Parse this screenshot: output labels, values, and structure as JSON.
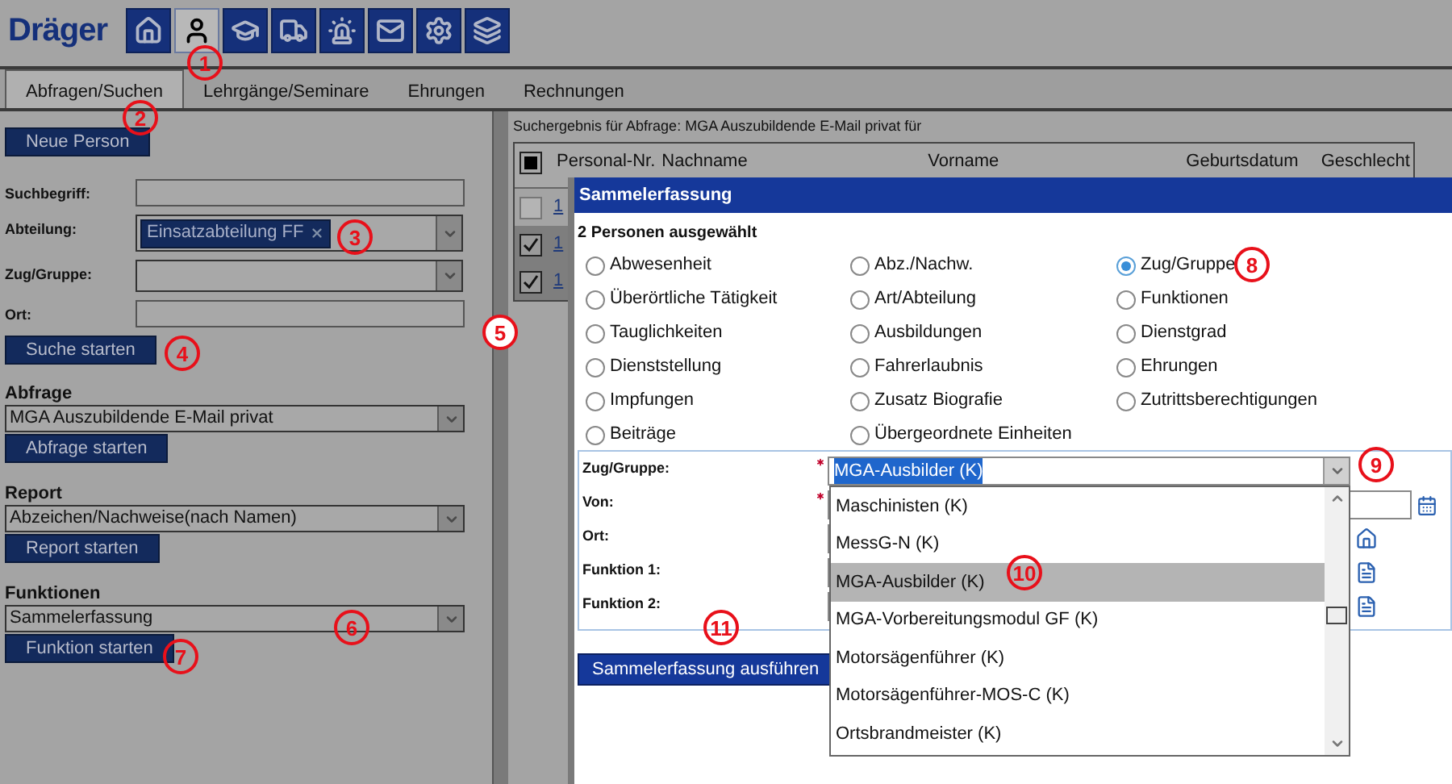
{
  "header": {
    "logo": "Dräger",
    "nav": [
      {
        "kind": "home",
        "selected": false
      },
      {
        "kind": "person",
        "selected": true
      },
      {
        "kind": "training",
        "selected": false
      },
      {
        "kind": "vehicle",
        "selected": false
      },
      {
        "kind": "alarm",
        "selected": false
      },
      {
        "kind": "mail",
        "selected": false
      },
      {
        "kind": "settings",
        "selected": false
      },
      {
        "kind": "layers",
        "selected": false
      }
    ]
  },
  "tabs": [
    {
      "label": "Abfragen/Suchen",
      "selected": true
    },
    {
      "label": "Lehrgänge/Seminare",
      "selected": false
    },
    {
      "label": "Ehrungen",
      "selected": false
    },
    {
      "label": "Rechnungen",
      "selected": false
    }
  ],
  "left_panel": {
    "new_button": "Neue Person",
    "search_fields": [
      {
        "label": "Suchbegriff:",
        "kind": "text"
      },
      {
        "label": "Abteilung:",
        "kind": "select",
        "tags": [
          "Einsatzabteilung FF"
        ]
      },
      {
        "label": "Zug/Gruppe:",
        "kind": "select"
      },
      {
        "label": "Ort:",
        "kind": "text"
      }
    ],
    "search_button": "Suche starten",
    "sections": [
      {
        "title": "Abfrage",
        "value": "MGA Auszubildende E-Mail privat",
        "button": "Abfrage starten"
      },
      {
        "title": "Report",
        "value": "Abzeichen/Nachweise(nach Namen)",
        "button": "Report starten"
      },
      {
        "title": "Funktionen",
        "value": "Sammelerfassung",
        "button": "Funktion starten"
      }
    ]
  },
  "results": {
    "caption": "Suchergebnis für Abfrage: MGA Auszubildende E-Mail privat für",
    "columns": [
      "Personal-Nr.",
      "Nachname",
      "Vorname",
      "Geburtsdatum",
      "Geschlecht"
    ],
    "select_all_checked": true,
    "rows": [
      {
        "checked": false,
        "selected": false,
        "number": "1"
      },
      {
        "checked": true,
        "selected": true,
        "number": "1"
      },
      {
        "checked": true,
        "selected": true,
        "number": "1"
      }
    ]
  },
  "dialog": {
    "title": "Sammelerfassung",
    "subtitle": "2 Personen ausgewählt",
    "options": [
      {
        "label": "Abwesenheit",
        "selected": false
      },
      {
        "label": "Abz./Nachw.",
        "selected": false
      },
      {
        "label": "Zug/Gruppe",
        "selected": true
      },
      {
        "label": "Überörtliche Tätigkeit",
        "selected": false
      },
      {
        "label": "Art/Abteilung",
        "selected": false
      },
      {
        "label": "Funktionen",
        "selected": false
      },
      {
        "label": "Tauglichkeiten",
        "selected": false
      },
      {
        "label": "Ausbildungen",
        "selected": false
      },
      {
        "label": "Dienstgrad",
        "selected": false
      },
      {
        "label": "Dienststellung",
        "selected": false
      },
      {
        "label": "Fahrerlaubnis",
        "selected": false
      },
      {
        "label": "Ehrungen",
        "selected": false
      },
      {
        "label": "Impfungen",
        "selected": false
      },
      {
        "label": "Zusatz Biografie",
        "selected": false
      },
      {
        "label": "Zutrittsberechtigungen",
        "selected": false
      },
      {
        "label": "Beiträge",
        "selected": false
      },
      {
        "label": "Übergeordnete Einheiten",
        "selected": false
      }
    ],
    "fields": [
      {
        "label": "Zug/Gruppe:",
        "required": true,
        "kind": "select"
      },
      {
        "label": "Von:",
        "required": true,
        "kind": "date"
      },
      {
        "label": "Ort:",
        "required": false,
        "kind": "place"
      },
      {
        "label": "Funktion 1:",
        "required": false,
        "kind": "list"
      },
      {
        "label": "Funktion 2:",
        "required": false,
        "kind": "list"
      }
    ],
    "dropdown": {
      "value": "MGA-Ausbilder (K)",
      "items": [
        {
          "label": "Maschinisten (K)",
          "selected": false
        },
        {
          "label": "MessG-N (K)",
          "selected": false
        },
        {
          "label": "MGA-Ausbilder (K)",
          "selected": true
        },
        {
          "label": "MGA-Vorbereitungsmodul GF (K)",
          "selected": false
        },
        {
          "label": "Motorsägenführer (K)",
          "selected": false
        },
        {
          "label": "Motorsägenführer-MOS-C (K)",
          "selected": false
        },
        {
          "label": "Ortsbrandmeister (K)",
          "selected": false
        }
      ]
    },
    "execute_button": "Sammelerfassung ausführen"
  },
  "callouts": [
    "1",
    "2",
    "3",
    "4",
    "5",
    "6",
    "7",
    "8",
    "9",
    "10",
    "11"
  ]
}
